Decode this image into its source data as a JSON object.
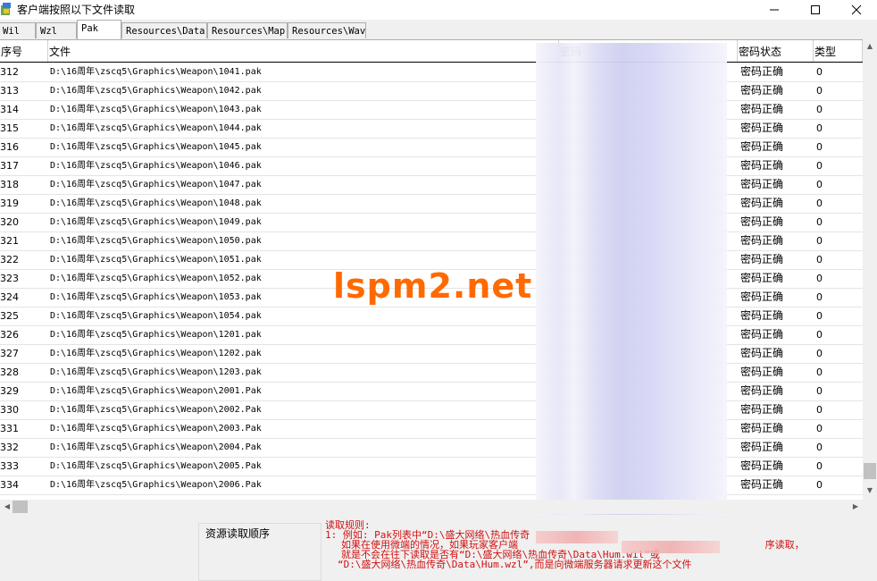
{
  "window": {
    "title": "客户端按照以下文件读取",
    "minimize_icon": "minimize-icon",
    "maximize_icon": "maximize-icon",
    "close_icon": "close-icon"
  },
  "tabs": [
    {
      "label": "Wil"
    },
    {
      "label": "Wzl"
    },
    {
      "label": "Pak",
      "active": true
    },
    {
      "label": "Resources\\Data"
    },
    {
      "label": "Resources\\Map"
    },
    {
      "label": "Resources\\Wav"
    }
  ],
  "columns": {
    "id": "序号",
    "file": "文件",
    "password": "密码",
    "status": "密码状态",
    "type": "类型"
  },
  "rows": [
    {
      "id": "312",
      "file": "D:\\16周年\\zscq5\\Graphics\\Weapon\\1041.pak",
      "status": "密码正确",
      "type": "0"
    },
    {
      "id": "313",
      "file": "D:\\16周年\\zscq5\\Graphics\\Weapon\\1042.pak",
      "status": "密码正确",
      "type": "0"
    },
    {
      "id": "314",
      "file": "D:\\16周年\\zscq5\\Graphics\\Weapon\\1043.pak",
      "status": "密码正确",
      "type": "0"
    },
    {
      "id": "315",
      "file": "D:\\16周年\\zscq5\\Graphics\\Weapon\\1044.pak",
      "status": "密码正确",
      "type": "0"
    },
    {
      "id": "316",
      "file": "D:\\16周年\\zscq5\\Graphics\\Weapon\\1045.pak",
      "status": "密码正确",
      "type": "0"
    },
    {
      "id": "317",
      "file": "D:\\16周年\\zscq5\\Graphics\\Weapon\\1046.pak",
      "status": "密码正确",
      "type": "0"
    },
    {
      "id": "318",
      "file": "D:\\16周年\\zscq5\\Graphics\\Weapon\\1047.pak",
      "status": "密码正确",
      "type": "0"
    },
    {
      "id": "319",
      "file": "D:\\16周年\\zscq5\\Graphics\\Weapon\\1048.pak",
      "status": "密码正确",
      "type": "0"
    },
    {
      "id": "320",
      "file": "D:\\16周年\\zscq5\\Graphics\\Weapon\\1049.pak",
      "status": "密码正确",
      "type": "0"
    },
    {
      "id": "321",
      "file": "D:\\16周年\\zscq5\\Graphics\\Weapon\\1050.pak",
      "status": "密码正确",
      "type": "0"
    },
    {
      "id": "322",
      "file": "D:\\16周年\\zscq5\\Graphics\\Weapon\\1051.pak",
      "status": "密码正确",
      "type": "0"
    },
    {
      "id": "323",
      "file": "D:\\16周年\\zscq5\\Graphics\\Weapon\\1052.pak",
      "status": "密码正确",
      "type": "0"
    },
    {
      "id": "324",
      "file": "D:\\16周年\\zscq5\\Graphics\\Weapon\\1053.pak",
      "status": "密码正确",
      "type": "0"
    },
    {
      "id": "325",
      "file": "D:\\16周年\\zscq5\\Graphics\\Weapon\\1054.pak",
      "status": "密码正确",
      "type": "0"
    },
    {
      "id": "326",
      "file": "D:\\16周年\\zscq5\\Graphics\\Weapon\\1201.pak",
      "status": "密码正确",
      "type": "0"
    },
    {
      "id": "327",
      "file": "D:\\16周年\\zscq5\\Graphics\\Weapon\\1202.pak",
      "status": "密码正确",
      "type": "0"
    },
    {
      "id": "328",
      "file": "D:\\16周年\\zscq5\\Graphics\\Weapon\\1203.pak",
      "status": "密码正确",
      "type": "0"
    },
    {
      "id": "329",
      "file": "D:\\16周年\\zscq5\\Graphics\\Weapon\\2001.Pak",
      "status": "密码正确",
      "type": "0"
    },
    {
      "id": "330",
      "file": "D:\\16周年\\zscq5\\Graphics\\Weapon\\2002.Pak",
      "status": "密码正确",
      "type": "0"
    },
    {
      "id": "331",
      "file": "D:\\16周年\\zscq5\\Graphics\\Weapon\\2003.Pak",
      "status": "密码正确",
      "type": "0"
    },
    {
      "id": "332",
      "file": "D:\\16周年\\zscq5\\Graphics\\Weapon\\2004.Pak",
      "status": "密码正确",
      "type": "0"
    },
    {
      "id": "333",
      "file": "D:\\16周年\\zscq5\\Graphics\\Weapon\\2005.Pak",
      "status": "密码正确",
      "type": "0"
    },
    {
      "id": "334",
      "file": "D:\\16周年\\zscq5\\Graphics\\Weapon\\2006.Pak",
      "status": "密码正确",
      "type": "0"
    }
  ],
  "bottom": {
    "order_label": "资源读取顺序",
    "rules": [
      "读取规则:",
      "1: 例如: Pak列表中“D:\\盛大网络\\热血传奇",
      "如果在使用微端的情况，如果玩家客户端",
      "就是不会在往下读取是否有“D:\\盛大网络\\热血传奇\\Data\\Hum.wil”或",
      "“D:\\盛大网络\\热血传奇\\Data\\Hum.wzl”,而是向微端服务器请求更新这个文件"
    ],
    "rules_tail": "序读取，",
    "colors": {
      "rules_text": "#d01010"
    }
  },
  "watermark": "lspm2.net"
}
